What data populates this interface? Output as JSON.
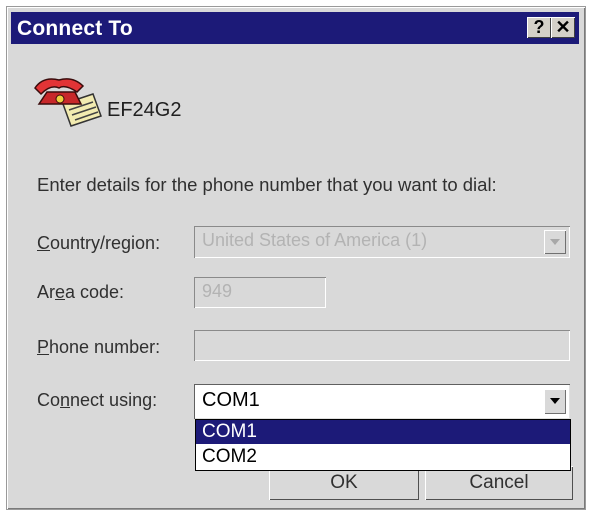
{
  "window": {
    "title": "Connect To",
    "help_label": "?",
    "close_label": "✕"
  },
  "connection": {
    "icon": "telephone-icon",
    "name": "EF24G2"
  },
  "instructions": "Enter details for the phone number that you want to dial:",
  "country": {
    "label_pre": "",
    "label_ul": "C",
    "label_post": "ountry/region:",
    "value": "United States of America (1)",
    "enabled": false
  },
  "area": {
    "label_pre": "Ar",
    "label_ul": "e",
    "label_post": "a code:",
    "value": "949",
    "enabled": false
  },
  "phone": {
    "label_pre": "",
    "label_ul": "P",
    "label_post": "hone number:",
    "value": "",
    "enabled": false
  },
  "connect_using": {
    "label_pre": "Co",
    "label_ul": "n",
    "label_post": "nect using:",
    "value": "COM1",
    "options": [
      "COM1",
      "COM2"
    ],
    "selected_index": 0,
    "expanded": true
  },
  "buttons": {
    "ok": "OK",
    "cancel": "Cancel"
  },
  "colors": {
    "title_bar": "#1c1a78",
    "selection": "#1c1a78",
    "dialog_bg": "#d9d9d9"
  }
}
